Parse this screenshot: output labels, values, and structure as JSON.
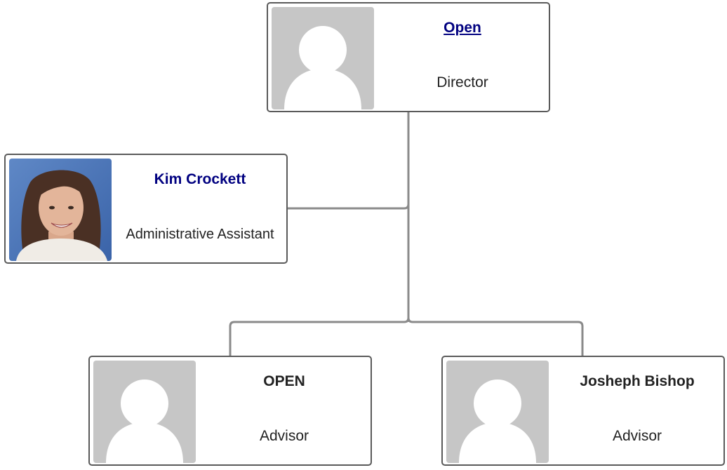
{
  "org_chart": {
    "director": {
      "name": "Open",
      "title": "Director",
      "photo": "placeholder-silhouette-icon",
      "name_color": "#000080",
      "name_underlined": true
    },
    "assistant": {
      "name": "Kim Crockett",
      "title": "Administrative Assistant",
      "photo": "employee-photo",
      "name_color": "#000080"
    },
    "advisor_left": {
      "name": "OPEN",
      "title": "Advisor",
      "photo": "placeholder-silhouette-icon",
      "name_color": "#222222"
    },
    "advisor_right": {
      "name": "Josheph Bishop",
      "title": "Advisor",
      "photo": "placeholder-silhouette-icon",
      "name_color": "#222222"
    }
  },
  "colors": {
    "card_border": "#5a5a5a",
    "connector": "#8a8a8a",
    "placeholder_bg": "#c6c6c6",
    "placeholder_figure": "#ffffff",
    "link": "#000080"
  }
}
